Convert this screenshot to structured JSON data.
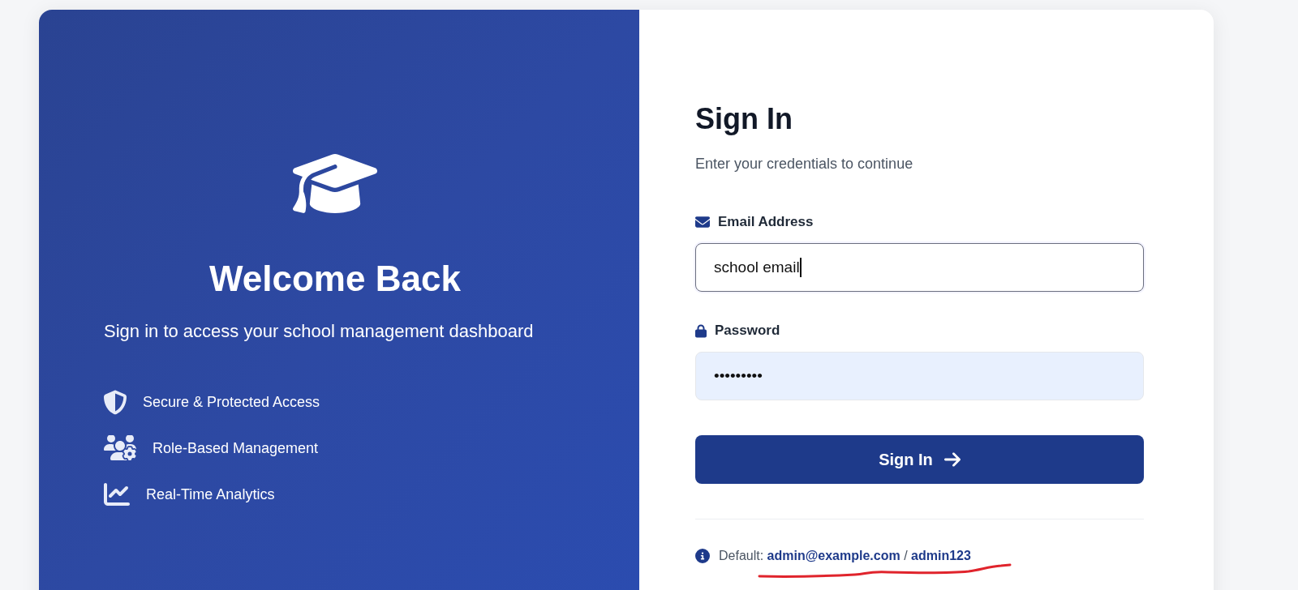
{
  "hero": {
    "title": "Welcome Back",
    "subtitle": "Sign in to access your school management dashboard",
    "features": [
      {
        "kind": "security",
        "label": "Secure & Protected Access"
      },
      {
        "kind": "roles",
        "label": "Role-Based Management"
      },
      {
        "kind": "analytics",
        "label": "Real-Time Analytics"
      }
    ]
  },
  "form": {
    "title": "Sign In",
    "subtitle": "Enter your credentials to continue",
    "fields": [
      {
        "kind": "email",
        "label": "Email Address",
        "value": "school email",
        "focused": true,
        "autofilled": false
      },
      {
        "kind": "password",
        "label": "Password",
        "value": "•••••••••",
        "focused": false,
        "autofilled": true
      }
    ],
    "submit": {
      "label": "Sign In"
    },
    "hint": "Default: **admin@example.com** / **admin123**",
    "hint_marked": true
  }
}
